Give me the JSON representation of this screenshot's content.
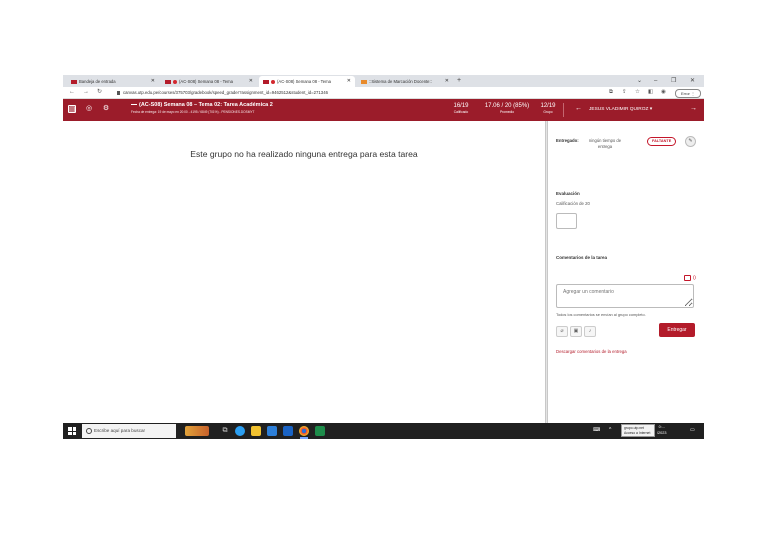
{
  "browser": {
    "tabs": [
      {
        "label": "Bandeja de entrada"
      },
      {
        "label": "(AC-S08) Semana 08 - Tema"
      },
      {
        "label": "(AC-S08) Semana 08 - Tema"
      },
      {
        "label": "::Sistema de Marcación Docente::"
      }
    ],
    "new_tab": "+",
    "window_controls": [
      "⌄",
      "–",
      "❐",
      "✕"
    ],
    "url": "canvas.utp.edu.pe/courses/375703/gradebook/speed_grader?assignment_id=9462512&student_id=271346",
    "error_label": "Error"
  },
  "header": {
    "course_title": "(AC-S08) Semana 08 – Tema 02: Tarea Académica 2",
    "due_date": "Fecha de entrega: 19 de mayo en 20:00 - 4195 / 6849 (701%) - PENSIONES.DOSMYT",
    "stats": [
      {
        "value": "16/19",
        "label": "Calificado"
      },
      {
        "value": "17.06 / 20 (85%)",
        "label": "Promedio"
      },
      {
        "value": "12/19",
        "label": "Grupo"
      }
    ],
    "student_name": "JESUS VLADIMIR QUIROZ",
    "prev_arrow": "←",
    "next_arrow": "→"
  },
  "main": {
    "message": "Este grupo no ha realizado ninguna entrega para esta tarea"
  },
  "sidebar": {
    "submitted_label": "Entregado:",
    "submitted_value": "ningún tiempo de entrega",
    "status_badge": "FALTANTE",
    "evaluation_heading": "Evaluación",
    "grade_label": "Calificación de 20",
    "grade_value": "",
    "comments_heading": "Comentarios de la tarea",
    "comment_count": "0",
    "comment_placeholder": "Agregar un comentario",
    "group_note": "Todos los comentarios se envían al grupo completo.",
    "submit_label": "Entregar",
    "download_link": "Descargar comentarios de la entrega"
  },
  "taskbar": {
    "search_placeholder": "Escribe aquí para buscar",
    "tooltip_line1": "grupo.utp.net",
    "tooltip_line2": "Acceso a Internet",
    "clock_time": "0:...",
    "clock_date": "/2023"
  },
  "colors": {
    "brand": "#9b1c2a",
    "accent": "#b31b2a",
    "taskbar": "#202020"
  }
}
